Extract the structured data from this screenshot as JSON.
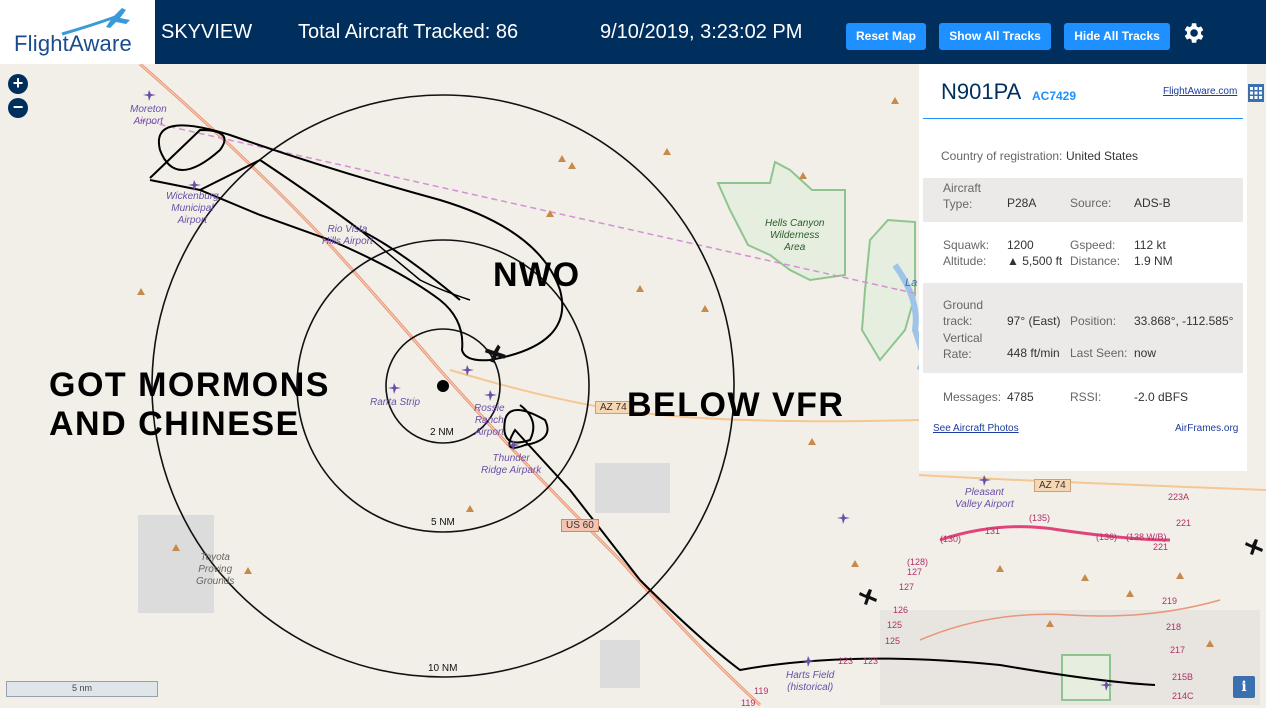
{
  "brand": {
    "name": "FlightAware"
  },
  "header": {
    "app_name": "SKYVIEW",
    "aircraft_tracked": "Total Aircraft Tracked: 86",
    "datetime": "9/10/2019, 3:23:02 PM",
    "buttons": {
      "reset": "Reset Map",
      "show_tracks": "Show All Tracks",
      "hide_tracks": "Hide All Tracks"
    },
    "settings_icon": "gear-icon"
  },
  "map": {
    "zoom_in": "+",
    "zoom_out": "−",
    "range_rings": [
      "2 NM",
      "5 NM",
      "10 NM"
    ],
    "scale": "5 nm",
    "places": {
      "moreton": "Moreton\nAirport",
      "wickenburg": "Wickenburg\nMunicipal\nAirport",
      "rio_vista": "Rio Vista\nHills Airport",
      "hells_canyon": "Hells Canyon\nWilderness\nArea",
      "ranta": "Ranta Strip",
      "rossie": "Rossie\nRanch\nAirport",
      "thunder": "Thunder\nRidge Airpark",
      "toyota": "Toyota\nProving\nGrounds",
      "pleasant": "Pleasant\nValley Airport",
      "harts": "Harts Field\n(historical)",
      "lake": "La"
    },
    "shields": {
      "az74_a": "AZ 74",
      "az74_b": "AZ 74",
      "us60": "US 60"
    },
    "road_labels": [
      "(135)",
      "(136)",
      "(138 W/B)",
      "221",
      "221",
      "223A",
      "(130)",
      "131",
      "(128)",
      "127",
      "127",
      "126",
      "125",
      "125",
      "123",
      "123",
      "119",
      "119",
      "219",
      "218",
      "217",
      "215B",
      "214C"
    ],
    "overlays": {
      "nwo": "NWO",
      "got": "GOT MORMONS\nAND CHINESE",
      "vfr": "BELOW VFR"
    }
  },
  "panel": {
    "registration": "N901PA",
    "callsign": "AC7429",
    "link": "FlightAware.com",
    "country_label": "Country of registration:",
    "country": "United States",
    "aircraft_type_label": "Aircraft\nType:",
    "aircraft_type": "P28A",
    "source_label": "Source:",
    "source": "ADS-B",
    "squawk_label": "Squawk:",
    "squawk": "1200",
    "gspeed_label": "Gspeed:",
    "gspeed": "112 kt",
    "altitude_label": "Altitude:",
    "altitude": "▲ 5,500 ft",
    "distance_label": "Distance:",
    "distance": "1.9 NM",
    "track_label": "Ground\ntrack:",
    "track": "97° (East)",
    "position_label": "Position:",
    "position": "33.868°, -112.585°",
    "vrate_label": "Vertical\nRate:",
    "vrate": "448 ft/min",
    "lastseen_label": "Last Seen:",
    "lastseen": "now",
    "messages_label": "Messages:",
    "messages": "4785",
    "rssi_label": "RSSI:",
    "rssi": "-2.0 dBFS",
    "photos_link": "See Aircraft Photos",
    "airframes_link": "AirFrames.org"
  },
  "colors": {
    "header": "#002f5d",
    "button": "#1e90ff",
    "map_bg": "#f2efe9",
    "road_primary": "#e9967a",
    "road_secondary": "#f4c794",
    "wilderness": "#8fc48f",
    "airport_label": "#6a4fa8"
  }
}
